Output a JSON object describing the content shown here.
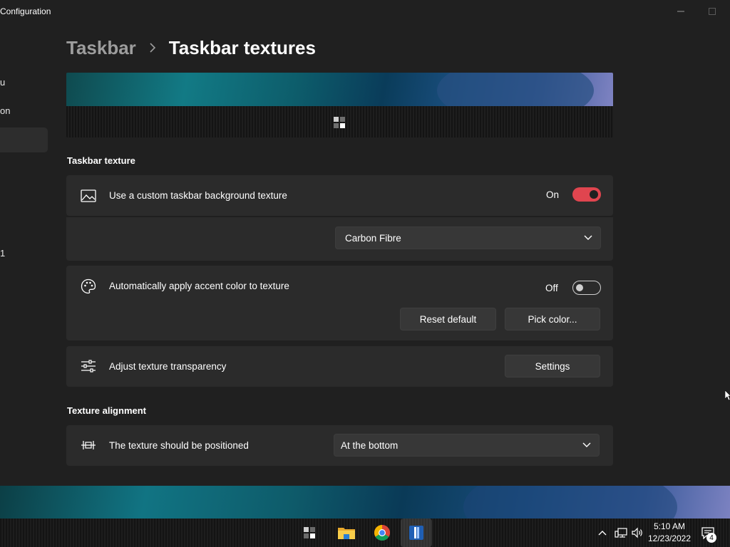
{
  "window": {
    "title": "Configuration"
  },
  "sidebar": {
    "items": [
      {
        "label": "u"
      },
      {
        "label": "on"
      },
      {
        "label": "1"
      }
    ]
  },
  "breadcrumb": {
    "parent": "Taskbar",
    "current": "Taskbar textures"
  },
  "sections": {
    "texture": "Taskbar texture",
    "alignment": "Texture alignment"
  },
  "settings": {
    "custom_texture": {
      "label": "Use a custom taskbar background texture",
      "state": "On",
      "enabled": true,
      "icon": "image-icon",
      "selected_texture": "Carbon Fibre"
    },
    "accent_color": {
      "label": "Automatically apply accent color to texture",
      "state": "Off",
      "enabled": false,
      "icon": "palette-icon",
      "reset_label": "Reset default",
      "pick_label": "Pick color..."
    },
    "transparency": {
      "label": "Adjust texture transparency",
      "icon": "sliders-icon",
      "button_label": "Settings"
    },
    "position": {
      "label": "The texture should be positioned",
      "icon": "align-icon",
      "selected": "At the bottom"
    }
  },
  "taskbar": {
    "clock_time": "5:10 AM",
    "clock_date": "12/23/2022",
    "notification_count": "4"
  },
  "colors": {
    "accent": "#e0454f",
    "background": "#202020",
    "card": "#2b2b2b"
  }
}
